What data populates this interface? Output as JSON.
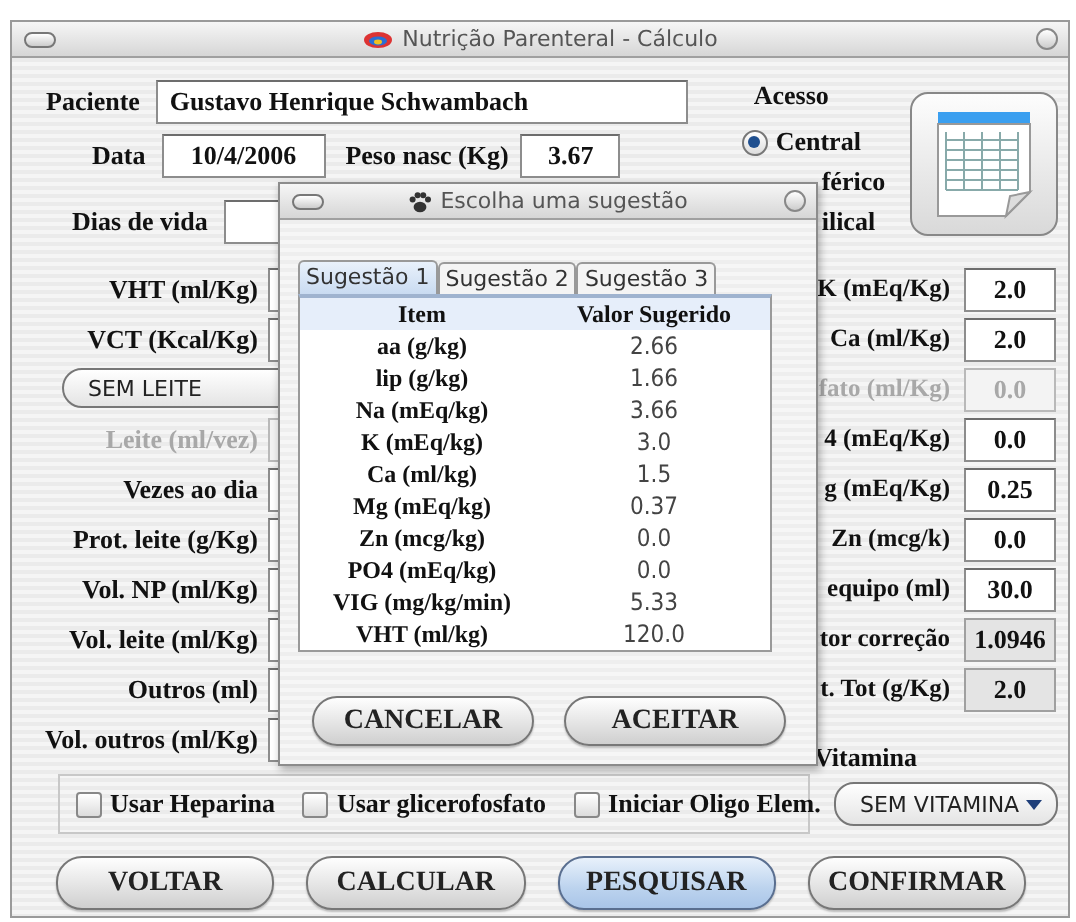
{
  "window": {
    "title": "Nutrição Parenteral - Cálculo"
  },
  "patient": {
    "label": "Paciente",
    "value": "Gustavo Henrique Schwambach"
  },
  "date": {
    "label": "Data",
    "value": "10/4/2006"
  },
  "birth_weight": {
    "label": "Peso nasc (Kg)",
    "value": "3.67"
  },
  "days_of_life": {
    "label": "Dias de vida"
  },
  "access": {
    "label": "Acesso",
    "options": [
      {
        "label": "Central",
        "selected": true
      },
      {
        "label": "férico"
      },
      {
        "label": "ilical"
      }
    ]
  },
  "left_fields": [
    {
      "kind": "field",
      "label": "VHT (ml/Kg)",
      "disabled": false
    },
    {
      "kind": "field",
      "label": "VCT (Kcal/Kg)",
      "disabled": false
    },
    {
      "kind": "combo",
      "value": "SEM LEITE"
    },
    {
      "kind": "field",
      "label": "Leite (ml/vez)",
      "disabled": true
    },
    {
      "kind": "field",
      "label": "Vezes ao dia",
      "disabled": false
    },
    {
      "kind": "field",
      "label": "Prot. leite (g/Kg)",
      "disabled": false
    },
    {
      "kind": "field",
      "label": "Vol. NP (ml/Kg)",
      "disabled": false
    },
    {
      "kind": "field",
      "label": "Vol. leite (ml/Kg)",
      "disabled": false
    },
    {
      "kind": "field",
      "label": "Outros (ml)",
      "disabled": false
    },
    {
      "kind": "field",
      "label": "Vol. outros (ml/Kg)",
      "disabled": false
    }
  ],
  "right_fields": [
    {
      "label": "K (mEq/Kg)",
      "value": "2.0",
      "disabled": false,
      "readonly": false
    },
    {
      "label": "Ca (ml/Kg)",
      "value": "2.0",
      "disabled": false,
      "readonly": false
    },
    {
      "label": "fato (ml/Kg)",
      "value": "0.0",
      "disabled": true,
      "readonly": false
    },
    {
      "label": "4 (mEq/Kg)",
      "value": "0.0",
      "disabled": false,
      "readonly": false
    },
    {
      "label": "g (mEq/Kg)",
      "value": "0.25",
      "disabled": false,
      "readonly": false
    },
    {
      "label": "Zn (mcg/k)",
      "value": "0.0",
      "disabled": false,
      "readonly": false
    },
    {
      "label": "equipo (ml)",
      "value": "30.0",
      "disabled": false,
      "readonly": false
    },
    {
      "label": "tor correção",
      "value": "1.0946",
      "disabled": false,
      "readonly": true
    },
    {
      "label": "t. Tot (g/Kg)",
      "value": "2.0",
      "disabled": false,
      "readonly": true
    }
  ],
  "vitamin": {
    "label": "Vitamina",
    "value": "SEM VITAMINA"
  },
  "checkboxes": [
    {
      "label": "Usar Heparina",
      "checked": false
    },
    {
      "label": "Usar glicerofosfato",
      "checked": false
    },
    {
      "label": "Iniciar Oligo Elem.",
      "checked": false
    }
  ],
  "buttons": [
    {
      "label": "VOLTAR",
      "focused": false
    },
    {
      "label": "CALCULAR",
      "focused": false
    },
    {
      "label": "PESQUISAR",
      "focused": true
    },
    {
      "label": "CONFIRMAR",
      "focused": false
    }
  ],
  "dialog": {
    "title": "Escolha uma sugestão",
    "tabs": [
      {
        "label": "Sugestão 1",
        "selected": true
      },
      {
        "label": "Sugestão 2",
        "selected": false
      },
      {
        "label": "Sugestão 3",
        "selected": false
      }
    ],
    "columns": [
      "Item",
      "Valor Sugerido"
    ],
    "rows": [
      [
        "aa (g/kg)",
        "2.66"
      ],
      [
        "lip (g/kg)",
        "1.66"
      ],
      [
        "Na (mEq/kg)",
        "3.66"
      ],
      [
        "K (mEq/kg)",
        "3.0"
      ],
      [
        "Ca (ml/kg)",
        "1.5"
      ],
      [
        "Mg (mEq/kg)",
        "0.37"
      ],
      [
        "Zn (mcg/kg)",
        "0.0"
      ],
      [
        "PO4 (mEq/kg)",
        "0.0"
      ],
      [
        "VIG (mg/kg/min)",
        "5.33"
      ],
      [
        "VHT (ml/kg)",
        "120.0"
      ]
    ],
    "buttons": [
      "CANCELAR",
      "ACEITAR"
    ]
  }
}
